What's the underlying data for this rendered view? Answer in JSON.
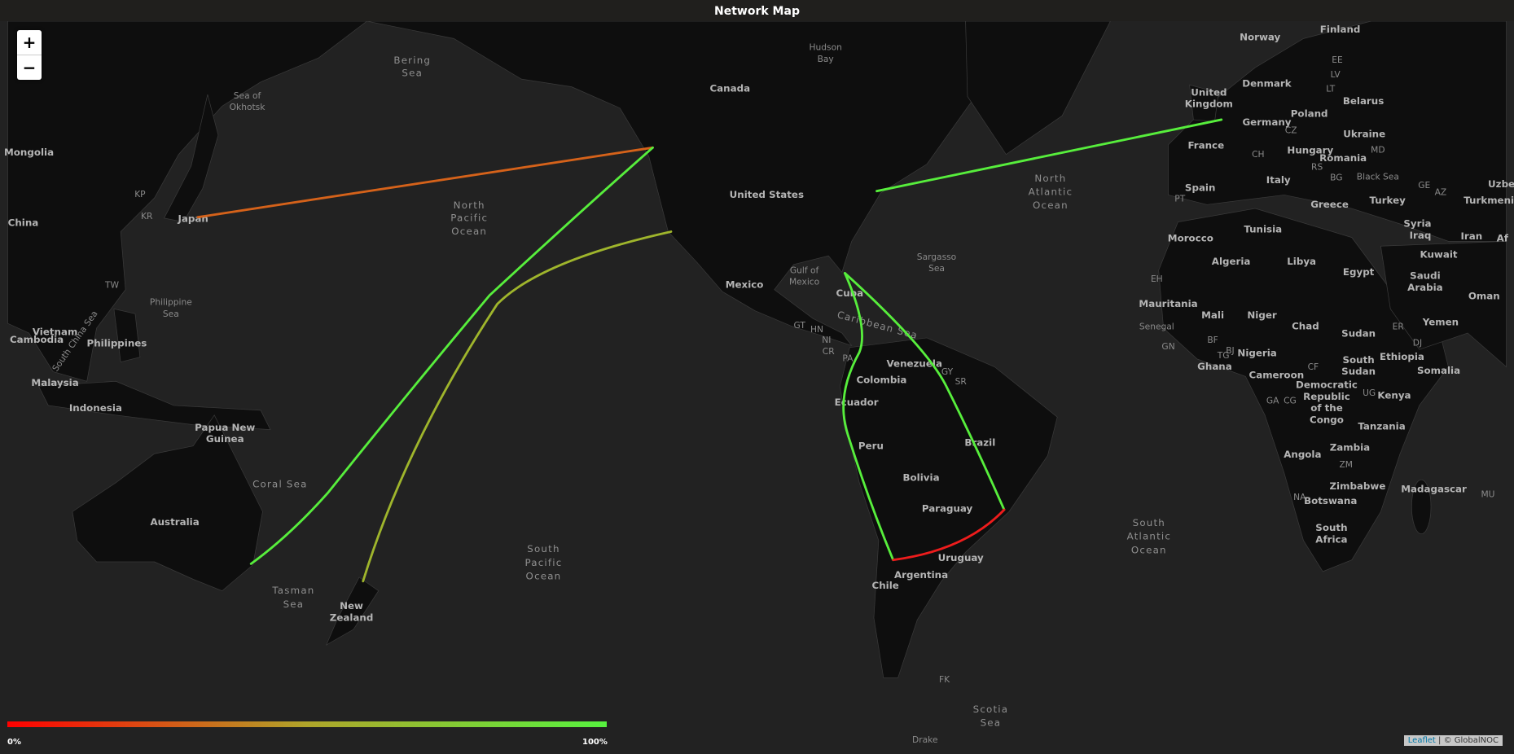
{
  "header": {
    "title": "Network Map"
  },
  "zoom": {
    "in_label": "+",
    "out_label": "−"
  },
  "legend": {
    "min_label": "0%",
    "max_label": "100%",
    "colors": [
      "#ff0000",
      "#57f23f"
    ]
  },
  "attribution": {
    "link_label": "Leaflet",
    "text": "| © GlobalNOC"
  },
  "link_colors": {
    "japan_seattle": "#d5621a",
    "seattle_sydney_a": "#a8c12a",
    "seattle_sydney_b": "#57ee3c",
    "la_nz": "#9fb52c",
    "ny_london": "#57ee3c",
    "florida_chile": "#57ee3c",
    "florida_brazil": "#57ee3c",
    "chile_brazil": "#ee1c1c"
  },
  "labels": {
    "countries": [
      "Canada",
      "United States",
      "Mexico",
      "Mongolia",
      "China",
      "Japan",
      "KP",
      "KR",
      "TW",
      "Vietnam",
      "Cambodia",
      "Philippines",
      "Malaysia",
      "Indonesia",
      "Papua New",
      "Guinea",
      "Australia",
      "New",
      "Zealand",
      "Cuba",
      "Venezuela",
      "Colombia",
      "Ecuador",
      "Peru",
      "Brazil",
      "Bolivia",
      "Paraguay",
      "Uruguay",
      "Argentina",
      "Chile",
      "GY",
      "SR",
      "GT",
      "HN",
      "NI",
      "CR",
      "PA",
      "FK",
      "United",
      "Kingdom",
      "Norway",
      "Finland",
      "Denmark",
      "Germany",
      "Poland",
      "Belarus",
      "Ukraine",
      "France",
      "Spain",
      "Italy",
      "Greece",
      "Turkey",
      "Romania",
      "Hungary",
      "BG",
      "MD",
      "Morocco",
      "Algeria",
      "Libya",
      "Egypt",
      "Tunisia",
      "Mali",
      "Niger",
      "Chad",
      "Sudan",
      "Mauritania",
      "Senegal",
      "Nigeria",
      "Ghana",
      "Cameroon",
      "Ethiopia",
      "South",
      "Sudan",
      "Somalia",
      "Kenya",
      "Tanzania",
      "Democratic",
      "Republic",
      "of the",
      "Congo",
      "Angola",
      "Zambia",
      "Zimbabwe",
      "Botswana",
      "NA",
      "South",
      "Africa",
      "Madagascar",
      "Syria",
      "Iraq",
      "Iran",
      "Kuwait",
      "Saudi",
      "Arabia",
      "Yemen",
      "Oman",
      "EH",
      "GN",
      "BF",
      "TG",
      "BJ",
      "CF",
      "GA",
      "CG",
      "UG",
      "ZM",
      "ER",
      "DJ",
      "EE",
      "LV",
      "LT",
      "CZ",
      "PT",
      "CH",
      "RS",
      "GE",
      "AZ",
      "MU",
      "Turkmeni",
      "Uzbe",
      "Af"
    ],
    "waters": [
      "Bering",
      "Sea",
      "Sea of",
      "Okhotsk",
      "Hudson",
      "Bay",
      "North",
      "Pacific",
      "Ocean",
      "Philippine",
      "Sea",
      "South China Sea",
      "Coral Sea",
      "Tasman",
      "Sea",
      "South",
      "Pacific",
      "Ocean",
      "Gulf of",
      "Mexico",
      "Caribbean Sea",
      "Sargasso",
      "Sea",
      "North",
      "Atlantic",
      "Ocean",
      "South",
      "Atlantic",
      "Ocean",
      "Black Sea",
      "Scotia",
      "Sea",
      "Drake"
    ]
  }
}
